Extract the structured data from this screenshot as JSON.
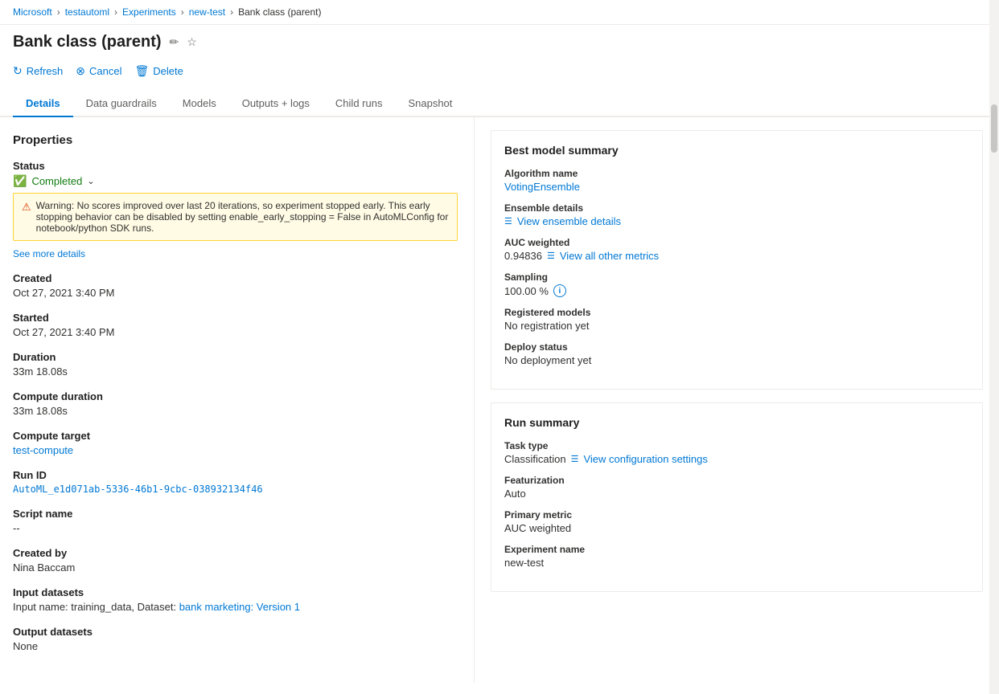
{
  "breadcrumb": {
    "items": [
      "Microsoft",
      "testautoml",
      "Experiments",
      "new-test",
      "Bank class (parent)"
    ]
  },
  "page": {
    "title": "Bank class (parent)",
    "edit_icon": "✏",
    "star_icon": "☆"
  },
  "toolbar": {
    "refresh_label": "Refresh",
    "cancel_label": "Cancel",
    "delete_label": "Delete"
  },
  "tabs": {
    "items": [
      "Details",
      "Data guardrails",
      "Models",
      "Outputs + logs",
      "Child runs",
      "Snapshot"
    ],
    "active": "Details"
  },
  "properties": {
    "title": "Properties",
    "status": {
      "label": "Status",
      "value": "Completed",
      "dropdown": "⌄"
    },
    "warning": {
      "text": "Warning: No scores improved over last 20 iterations, so experiment stopped early. This early stopping behavior can be disabled by setting enable_early_stopping = False in AutoMLConfig for notebook/python SDK runs."
    },
    "see_more": "See more details",
    "created": {
      "label": "Created",
      "value": "Oct 27, 2021 3:40 PM"
    },
    "started": {
      "label": "Started",
      "value": "Oct 27, 2021 3:40 PM"
    },
    "duration": {
      "label": "Duration",
      "value": "33m 18.08s"
    },
    "compute_duration": {
      "label": "Compute duration",
      "value": "33m 18.08s"
    },
    "compute_target": {
      "label": "Compute target",
      "value": "test-compute"
    },
    "run_id": {
      "label": "Run ID",
      "value": "AutoML_e1d071ab-5336-46b1-9cbc-038932134f46"
    },
    "script_name": {
      "label": "Script name",
      "value": "--"
    },
    "created_by": {
      "label": "Created by",
      "value": "Nina Baccam"
    },
    "input_datasets": {
      "label": "Input datasets",
      "prefix": "Input name: training_data, Dataset: ",
      "link_text": "bank marketing: Version 1"
    },
    "output_datasets": {
      "label": "Output datasets",
      "value": "None"
    }
  },
  "best_model_summary": {
    "title": "Best model summary",
    "algorithm_name": {
      "label": "Algorithm name",
      "value": "VotingEnsemble"
    },
    "ensemble_details": {
      "label": "Ensemble details",
      "link_text": "View ensemble details"
    },
    "auc_weighted": {
      "label": "AUC weighted",
      "value": "0.94836",
      "link_text": "View all other metrics"
    },
    "sampling": {
      "label": "Sampling",
      "value": "100.00 %"
    },
    "registered_models": {
      "label": "Registered models",
      "value": "No registration yet"
    },
    "deploy_status": {
      "label": "Deploy status",
      "value": "No deployment yet"
    }
  },
  "run_summary": {
    "title": "Run summary",
    "task_type": {
      "label": "Task type",
      "value": "Classification",
      "link_text": "View configuration settings"
    },
    "featurization": {
      "label": "Featurization",
      "value": "Auto"
    },
    "primary_metric": {
      "label": "Primary metric",
      "value": "AUC weighted"
    },
    "experiment_name": {
      "label": "Experiment name",
      "value": "new-test"
    }
  }
}
